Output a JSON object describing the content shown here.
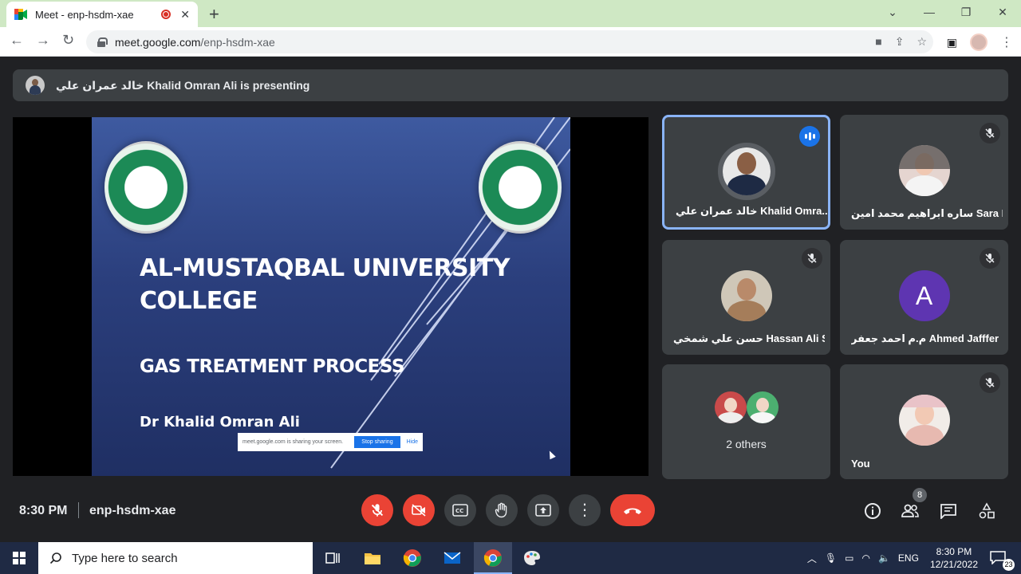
{
  "browser": {
    "tab_title": "Meet - enp-hsdm-xae",
    "url_host": "meet.google.com",
    "url_path": "/enp-hsdm-xae"
  },
  "meet": {
    "presenting_text": "خالد عمران علي Khalid Omran Ali is presenting",
    "slide": {
      "title_line1": "AL-MUSTAQBAL UNIVERSITY",
      "title_line2": "COLLEGE",
      "subtitle": "GAS TREATMENT PROCESS",
      "author": "Dr Khalid Omran Ali"
    },
    "share_bar": {
      "text": "meet.google.com is sharing your screen.",
      "stop_label": "Stop sharing",
      "hide_label": "Hide"
    },
    "participants": [
      {
        "name": "خالد عمران علي Khalid Omra...",
        "speaking": true
      },
      {
        "name": "ساره ابراهيم محمد امين Sara Ibr...",
        "muted": true
      },
      {
        "name": "حسن علي شمخي Hassan Ali Sh...",
        "muted": true
      },
      {
        "name": "م.م احمد جعفر Ahmed Jafffer",
        "muted": true,
        "initial": "A"
      },
      {
        "name": "2 others"
      },
      {
        "name": "You",
        "muted": true
      }
    ],
    "clock": "8:30 PM",
    "meeting_code": "enp-hsdm-xae",
    "people_count": "8"
  },
  "taskbar": {
    "search_placeholder": "Type here to search",
    "lang": "ENG",
    "time": "8:30 PM",
    "date": "12/21/2022",
    "notifications": "23"
  },
  "colors": {
    "accent": "#1a73e8",
    "danger": "#ea4335",
    "tile_bg": "#3c4043",
    "page_bg": "#202124"
  }
}
